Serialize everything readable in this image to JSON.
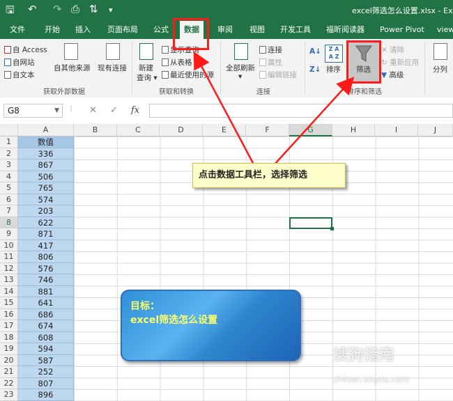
{
  "titlebar": {
    "save": "🖫",
    "undo": "↶",
    "redo": "↷",
    "preview": "⎙",
    "sort": "⇅",
    "more": "▾",
    "title": "excel筛选怎么设置.xlsx - Exc"
  },
  "tabs": [
    "文件",
    "开始",
    "插入",
    "页面布局",
    "公式",
    "数据",
    "审阅",
    "视图",
    "开发工具",
    "福昕阅读器",
    "Power Pivot",
    "view"
  ],
  "ribbon": {
    "access": "自 Access",
    "web": "自网站",
    "text": "自文本",
    "other_sources": "自其他来源",
    "existing_conn": "现有连接",
    "new_query_1": "新建",
    "new_query_2": "查询 ▾",
    "show_query": "显示查询",
    "from_table": "从表格",
    "recent_sources": "最近使用的源",
    "refresh_all_1": "全部刷新",
    "refresh_all_2": "▾",
    "connections": "连接",
    "properties": "属性",
    "edit_links": "编辑链接",
    "sort": "排序",
    "filter": "筛选",
    "clear": "清除",
    "reapply": "重新应用",
    "advanced": "高级",
    "split": "分列",
    "group_external": "获取外部数据",
    "group_transform": "获取和转换",
    "group_conn": "连接",
    "group_sortfilter": "排序和筛选"
  },
  "formula_bar": {
    "name_box": "G8",
    "cancel": "✕",
    "confirm": "✓",
    "fx": "fx",
    "formula": ""
  },
  "columns": [
    "A",
    "B",
    "C",
    "D",
    "E",
    "F",
    "G",
    "H",
    "I",
    "J"
  ],
  "rows": [
    "1",
    "2",
    "3",
    "4",
    "5",
    "6",
    "7",
    "8",
    "9",
    "10",
    "11",
    "12",
    "13",
    "14",
    "15",
    "16",
    "17",
    "18",
    "19",
    "20",
    "21",
    "22",
    "23"
  ],
  "column_a": [
    "数值",
    "336",
    "867",
    "506",
    "765",
    "574",
    "203",
    "622",
    "871",
    "417",
    "806",
    "576",
    "746",
    "881",
    "641",
    "686",
    "674",
    "608",
    "594",
    "587",
    "252",
    "807",
    "896"
  ],
  "callout": "点击数据工具栏，选择筛选",
  "goal_box": {
    "line1": "目标：",
    "line2": "excel筛选怎么设置"
  },
  "watermark": {
    "line1": "搜狗指南",
    "line2": "zhinan.sogou.com"
  },
  "colors": {
    "excel_green": "#217346",
    "highlight_red": "#ff1a1a",
    "column_fill": "#bdd7ee",
    "callout_fill": "#ffffcc",
    "goal_text": "#ffff66"
  }
}
